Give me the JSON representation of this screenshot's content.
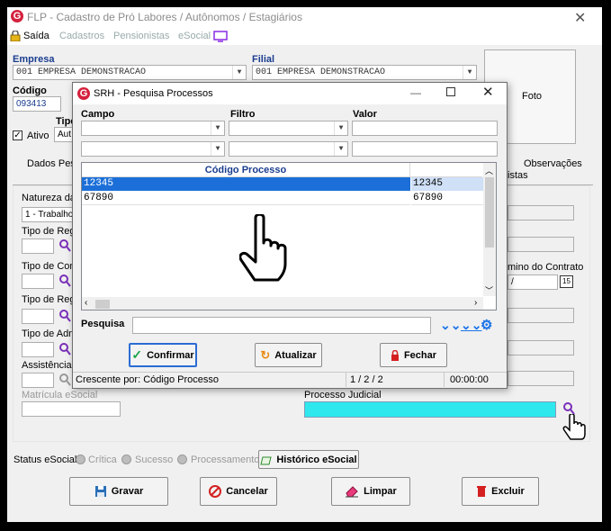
{
  "window": {
    "title": "FLP - Cadastro de Pró Labores / Autônomos / Estagiários",
    "close": "✕"
  },
  "menu": {
    "saida": "Saída",
    "cadastros": "Cadastros",
    "pensionistas": "Pensionistas",
    "esocial": "eSocial"
  },
  "form": {
    "empresa_label": "Empresa",
    "empresa_value": "001 EMPRESA DEMONSTRACAO",
    "filial_label": "Filial",
    "filial_value": "001 EMPRESA DEMONSTRACAO",
    "codigo_label": "Código",
    "codigo_value": "093413",
    "tipo_label": "Tipo",
    "ativo_label": "Ativo",
    "tipo_value": "Aut",
    "foto_label": "Foto"
  },
  "tabs": {
    "dados_pessoais": "Dados Pes",
    "observacoes": "Observações",
    "istas": "istas"
  },
  "panel": {
    "natureza_label": "Natureza da",
    "natureza_value": "1 - Trabalho",
    "tipo_regi_1": "Tipo de Regi",
    "tipo_cont": "Tipo de Cont",
    "tipo_regi_2": "Tipo de Regi",
    "tipo_admi": "Tipo de Admi",
    "assistencia": "Assistência M",
    "matricula_label": "Matrícula eSocial",
    "termino_label": "mino do Contrato",
    "termino_value": "/",
    "cal_icon": "15",
    "processo_label": "Processo Judicial"
  },
  "status": {
    "label": "Status eSocial:",
    "critica": "Crítica",
    "sucesso": "Sucesso",
    "processamento": "Processamento",
    "historico": "Histórico eSocial"
  },
  "buttons": {
    "gravar": "Gravar",
    "cancelar": "Cancelar",
    "limpar": "Limpar",
    "excluir": "Excluir"
  },
  "dialog": {
    "title": "SRH - Pesquisa Processos",
    "campo_label": "Campo",
    "filtro_label": "Filtro",
    "valor_label": "Valor",
    "grid_header": "Código Processo",
    "rows": [
      {
        "col1": "12345",
        "col2": "12345"
      },
      {
        "col1": "67890",
        "col2": "67890"
      }
    ],
    "pesquisa_label": "Pesquisa",
    "confirmar": "Confirmar",
    "atualizar": "Atualizar",
    "fechar": "Fechar",
    "status_order": "Crescente por: Código Processo",
    "status_pages": "1 / 2 / 2",
    "status_time": "00:00:00"
  }
}
